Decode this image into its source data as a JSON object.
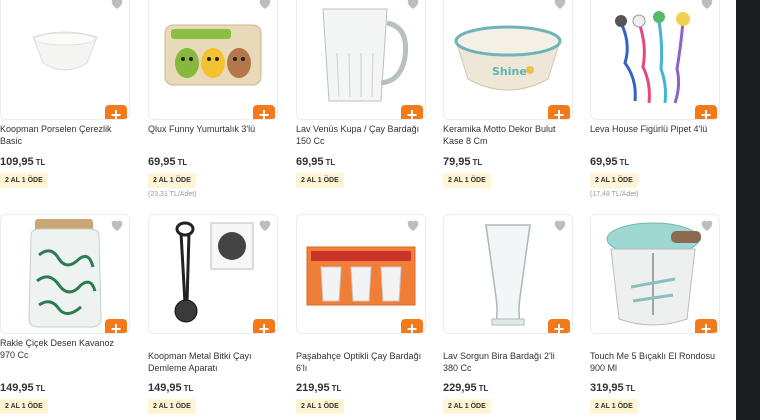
{
  "products": [
    {
      "name": "Koopman Porselen Çerezlik Basic",
      "price": "109,95",
      "currency": "TL",
      "badge": "2 AL 1 ÖDE",
      "unit": "",
      "icon": "bowl-image"
    },
    {
      "name": "Qlux Funny Yumurtalık 3'lü",
      "price": "69,95",
      "currency": "TL",
      "badge": "2 AL 1 ÖDE",
      "unit": "(23,31 TL/Adet)",
      "icon": "egg-cups-image"
    },
    {
      "name": "Lav Venüs Kupa / Çay Bardağı 150 Cc",
      "price": "69,95",
      "currency": "TL",
      "badge": "2 AL 1 ÖDE",
      "unit": "",
      "icon": "glass-mug-image"
    },
    {
      "name": "Keramika Motto Dekor Bulut Kase 8 Cm",
      "price": "79,95",
      "currency": "TL",
      "badge": "2 AL 1 ÖDE",
      "unit": "",
      "icon": "ceramic-bowl-image",
      "print": "Shine"
    },
    {
      "name": "Leva House Figürlü Pipet 4'lü",
      "price": "69,95",
      "currency": "TL",
      "badge": "2 AL 1 ÖDE",
      "unit": "(17,48 TL/Adet)",
      "icon": "straws-image"
    },
    {
      "name": "Rakle Çiçek Desen Kavanoz 970 Cc",
      "price": "149,95",
      "currency": "TL",
      "badge": "2 AL 1 ÖDE",
      "unit": "",
      "icon": "jar-image"
    },
    {
      "name": "Koopman Metal Bitki Çayı Demleme Aparatı",
      "price": "149,95",
      "currency": "TL",
      "badge": "2 AL 1 ÖDE",
      "unit": "",
      "icon": "tea-infuser-image"
    },
    {
      "name": "Paşabahçe Optikli Çay Bardağı 6'lı",
      "price": "219,95",
      "currency": "TL",
      "badge": "2 AL 1 ÖDE",
      "unit": "",
      "icon": "tea-glasses-box-image"
    },
    {
      "name": "Lav Sorgun Bira Bardağı 2'li 380 Cc",
      "price": "229,95",
      "currency": "TL",
      "badge": "2 AL 1 ÖDE",
      "unit": "",
      "icon": "beer-glass-image"
    },
    {
      "name": "Touch Me 5 Bıçaklı El Rondosu 900 Ml",
      "price": "319,95",
      "currency": "TL",
      "badge": "2 AL 1 ÖDE",
      "unit": "",
      "icon": "chopper-image"
    }
  ],
  "colors": {
    "accent": "#f27a1a",
    "badge_bg": "#fff4d4",
    "text": "#333333"
  }
}
